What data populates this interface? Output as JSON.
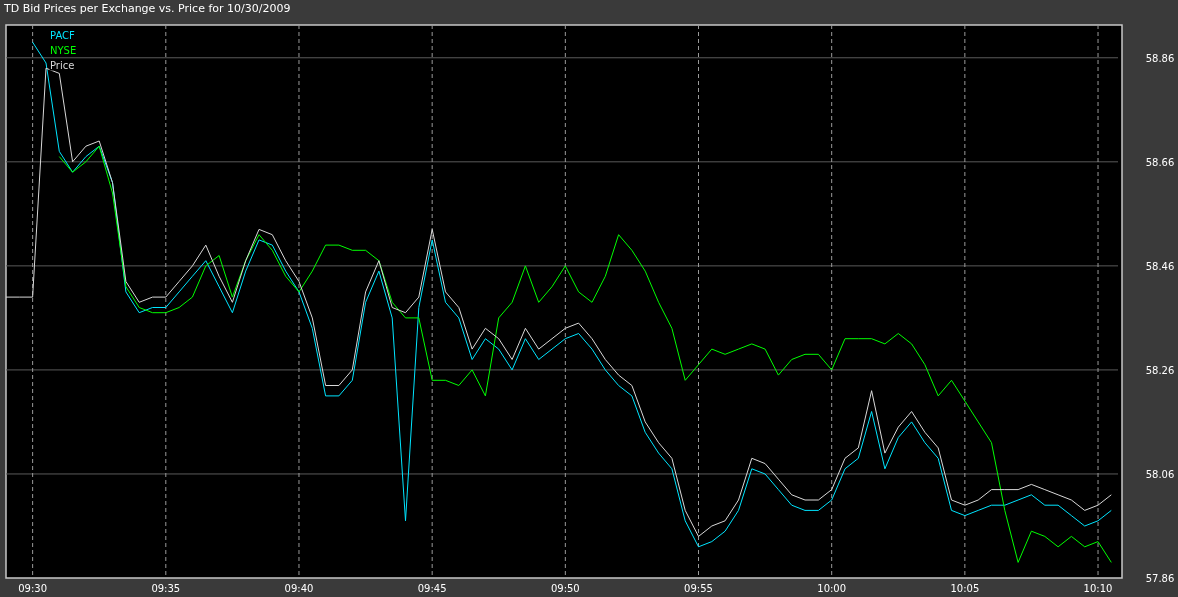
{
  "chart": {
    "chart_data": {
      "type": "line",
      "title": "TD Bid Prices per Exchange vs. Price for 10/30/2009",
      "grid": true,
      "categories": [
        null,
        null,
        "09:30",
        null,
        null,
        null,
        null,
        null,
        null,
        null,
        null,
        null,
        "09:35",
        null,
        null,
        null,
        null,
        null,
        null,
        null,
        null,
        null,
        "09:40",
        null,
        null,
        null,
        null,
        null,
        null,
        null,
        null,
        null,
        "09:45",
        null,
        null,
        null,
        null,
        null,
        null,
        null,
        null,
        null,
        "09:50",
        null,
        null,
        null,
        null,
        null,
        null,
        null,
        null,
        null,
        "09:55",
        null,
        null,
        null,
        null,
        null,
        null,
        null,
        null,
        null,
        "10:00",
        null,
        null,
        null,
        null,
        null,
        null,
        null,
        null,
        null,
        "10:05",
        null,
        null,
        null,
        null,
        null,
        null,
        null,
        null,
        null,
        "10:10",
        null
      ],
      "series": [
        {
          "name": "PACF",
          "color": "#00e5ff",
          "values": [
            null,
            null,
            58.89,
            58.85,
            58.68,
            58.64,
            58.67,
            58.69,
            58.62,
            58.41,
            58.37,
            58.38,
            58.38,
            58.41,
            58.44,
            58.47,
            58.42,
            58.37,
            58.45,
            58.51,
            58.5,
            58.45,
            58.41,
            58.34,
            58.21,
            58.21,
            58.24,
            58.39,
            58.45,
            58.36,
            57.97,
            58.38,
            58.51,
            58.39,
            58.36,
            58.28,
            58.32,
            58.3,
            58.26,
            58.32,
            58.28,
            58.3,
            58.32,
            58.33,
            58.3,
            58.26,
            58.23,
            58.21,
            58.14,
            58.1,
            58.07,
            57.97,
            57.92,
            57.93,
            57.95,
            57.99,
            58.07,
            58.06,
            58.03,
            58.0,
            57.99,
            57.99,
            58.01,
            58.07,
            58.09,
            58.18,
            58.07,
            58.13,
            58.16,
            58.12,
            58.09,
            57.99,
            57.98,
            57.99,
            58.0,
            58.0,
            58.01,
            58.02,
            58.0,
            58.0,
            57.98,
            57.96,
            57.97,
            57.99
          ]
        },
        {
          "name": "NYSE",
          "color": "#00ff00",
          "values": [
            null,
            null,
            null,
            null,
            58.67,
            58.64,
            58.66,
            58.69,
            58.6,
            58.42,
            58.38,
            58.37,
            58.37,
            58.38,
            58.4,
            58.46,
            58.48,
            58.4,
            58.47,
            58.52,
            58.49,
            58.44,
            58.41,
            58.45,
            58.5,
            58.5,
            58.49,
            58.49,
            58.47,
            58.39,
            58.36,
            58.36,
            58.24,
            58.24,
            58.23,
            58.26,
            58.21,
            58.36,
            58.39,
            58.46,
            58.39,
            58.42,
            58.46,
            58.41,
            58.39,
            58.44,
            58.52,
            58.49,
            58.45,
            58.39,
            58.34,
            58.24,
            58.27,
            58.3,
            58.29,
            58.3,
            58.31,
            58.3,
            58.25,
            58.28,
            58.29,
            58.29,
            58.26,
            58.32,
            58.32,
            58.32,
            58.31,
            58.33,
            58.31,
            58.27,
            58.21,
            58.24,
            58.2,
            58.16,
            58.12,
            57.99,
            57.89,
            57.95,
            57.94,
            57.92,
            57.94,
            57.92,
            57.93,
            57.89
          ]
        },
        {
          "name": "Price",
          "color": "#d8d8d8",
          "values": [
            58.4,
            58.4,
            58.4,
            58.84,
            58.83,
            58.66,
            58.69,
            58.7,
            58.62,
            58.43,
            58.39,
            58.4,
            58.4,
            58.43,
            58.46,
            58.5,
            58.44,
            58.39,
            58.47,
            58.53,
            58.52,
            58.47,
            58.43,
            58.36,
            58.23,
            58.23,
            58.26,
            58.41,
            58.47,
            58.38,
            58.37,
            58.4,
            58.53,
            58.41,
            58.38,
            58.3,
            58.34,
            58.32,
            58.28,
            58.34,
            58.3,
            58.32,
            58.34,
            58.35,
            58.32,
            58.28,
            58.25,
            58.23,
            58.16,
            58.12,
            58.09,
            57.99,
            57.94,
            57.96,
            57.97,
            58.01,
            58.09,
            58.08,
            58.05,
            58.02,
            58.01,
            58.01,
            58.03,
            58.09,
            58.11,
            58.22,
            58.1,
            58.15,
            58.18,
            58.14,
            58.11,
            58.01,
            58.0,
            58.01,
            58.03,
            58.03,
            58.03,
            58.04,
            58.03,
            58.02,
            58.01,
            57.99,
            58.0,
            58.02
          ]
        }
      ],
      "ylim": [
        57.86,
        58.923
      ],
      "yticks": [
        {
          "value": 57.86,
          "label": "57.86"
        },
        {
          "value": 58.06,
          "label": "58.06"
        },
        {
          "value": 58.26,
          "label": "58.26"
        },
        {
          "value": 58.46,
          "label": "58.46"
        },
        {
          "value": 58.66,
          "label": "58.66"
        },
        {
          "value": 58.86,
          "label": "58.86"
        }
      ]
    }
  }
}
